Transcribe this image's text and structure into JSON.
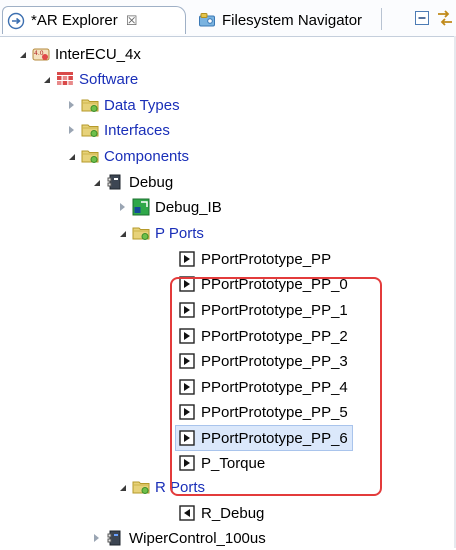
{
  "tabs": [
    {
      "label": "*AR Explorer",
      "close": "☒",
      "icon": "ar-explorer-icon",
      "active": true
    },
    {
      "label": "Filesystem Navigator",
      "icon": "filesystem-navigator-icon",
      "active": false
    }
  ],
  "toolbar": [
    {
      "icon": "collapse-all-icon"
    },
    {
      "icon": "link-with-editor-icon"
    }
  ],
  "tree": {
    "root": {
      "label": "InterECU_4x",
      "icon": "autosar-project-icon"
    },
    "software": {
      "label": "Software",
      "icon": "software-package-icon"
    },
    "data_types": {
      "label": "Data Types",
      "icon": "folder-icon"
    },
    "interfaces": {
      "label": "Interfaces",
      "icon": "folder-icon"
    },
    "components": {
      "label": "Components",
      "icon": "folder-icon"
    },
    "debug": {
      "label": "Debug",
      "icon": "component-icon"
    },
    "debug_ib": {
      "label": "Debug_IB",
      "icon": "internal-behavior-icon"
    },
    "p_ports": {
      "label": "P Ports",
      "icon": "folder-icon"
    },
    "p_port_items": [
      {
        "label": "PPortPrototype_PP"
      },
      {
        "label": "PPortPrototype_PP_0"
      },
      {
        "label": "PPortPrototype_PP_1"
      },
      {
        "label": "PPortPrototype_PP_2"
      },
      {
        "label": "PPortPrototype_PP_3"
      },
      {
        "label": "PPortPrototype_PP_4"
      },
      {
        "label": "PPortPrototype_PP_5"
      },
      {
        "label": "PPortPrototype_PP_6"
      },
      {
        "label": "P_Torque"
      }
    ],
    "r_ports": {
      "label": "R Ports",
      "icon": "folder-icon"
    },
    "r_debug": {
      "label": "R_Debug",
      "icon": "r-port-icon"
    },
    "wiper": {
      "label": "WiperControl_100us",
      "icon": "component-icon"
    }
  },
  "colors": {
    "link_blue": "#1a2fb8",
    "highlight": "#e33b3b",
    "folder": "#d9c35a"
  }
}
